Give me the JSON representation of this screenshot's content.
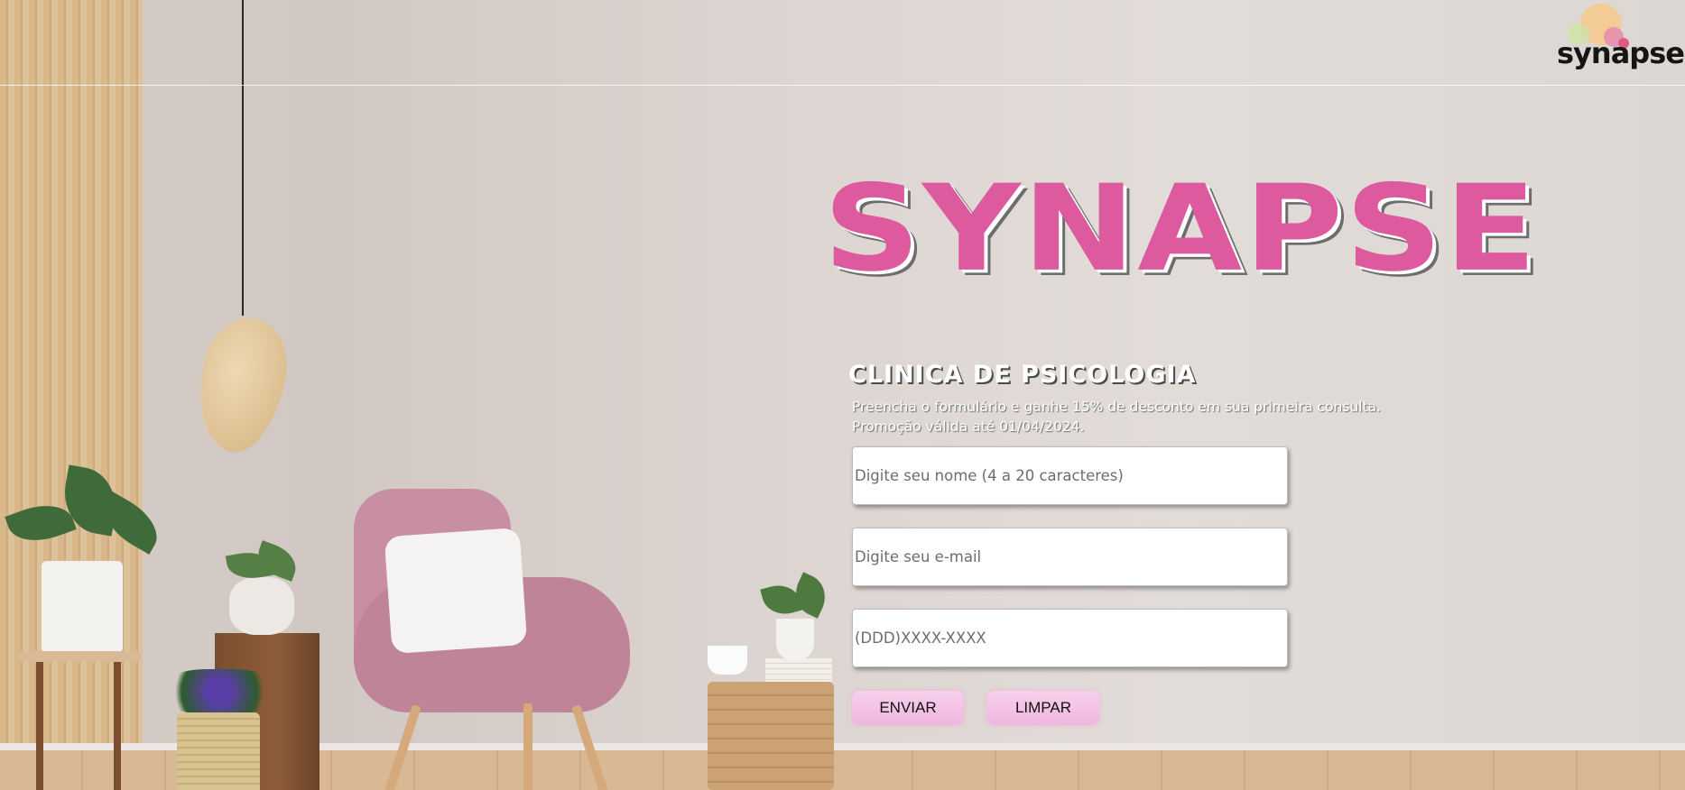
{
  "logo": {
    "text": "synapse"
  },
  "brand": {
    "title": "SYNAPSE"
  },
  "section": {
    "subtitle": "CLINICA DE PSICOLOGIA",
    "promo_line1": "Preencha o formulário e ganhe 15% de desconto em sua primeira consulta.",
    "promo_line2": "Promoção válida até 01/04/2024."
  },
  "form": {
    "name_placeholder": "Digite seu nome (4 a 20 caracteres)",
    "email_placeholder": "Digite seu e-mail",
    "phone_placeholder": "(DDD)XXXX-XXXX",
    "submit_label": "ENVIAR",
    "clear_label": "LIMPAR"
  },
  "colors": {
    "brand_pink": "#dd5a9e",
    "button_pink": "#f3c1e4"
  }
}
